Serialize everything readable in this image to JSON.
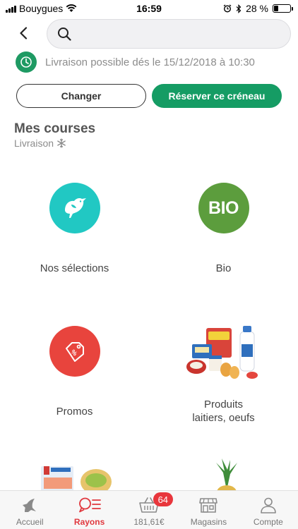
{
  "status_bar": {
    "carrier": "Bouygues",
    "time": "16:59",
    "battery_percent": "28 %",
    "battery_level": 0.28
  },
  "search": {
    "value": "",
    "placeholder": ""
  },
  "delivery": {
    "message": "Livraison possible dés le 15/12/2018 à 10:30"
  },
  "actions": {
    "change_label": "Changer",
    "reserve_label": "Réserver ce créneau"
  },
  "section": {
    "title": "Mes courses",
    "subtitle": "Livraison"
  },
  "categories": [
    {
      "label": "Nos sélections",
      "icon": "bird-icon",
      "color": "#21c8c3"
    },
    {
      "label": "Bio",
      "icon": "bio-logo",
      "badge_text": "BIO",
      "color": "#5c9d3d"
    },
    {
      "label": "Promos",
      "icon": "price-tag-icon",
      "color": "#e8443d"
    },
    {
      "label": "Produits\nlaitiers, oeufs",
      "icon": "dairy-products-image"
    }
  ],
  "bottom_nav": {
    "items": [
      {
        "label": "Accueil",
        "icon": "home-logo-icon",
        "active": false
      },
      {
        "label": "Rayons",
        "icon": "aisles-icon",
        "active": true
      },
      {
        "label": "181,61€",
        "icon": "basket-icon",
        "active": false,
        "badge": "64"
      },
      {
        "label": "Magasins",
        "icon": "store-icon",
        "active": false
      },
      {
        "label": "Compte",
        "icon": "account-icon",
        "active": false
      }
    ]
  },
  "colors": {
    "accent_green": "#159c64",
    "active_red": "#e0383e"
  }
}
